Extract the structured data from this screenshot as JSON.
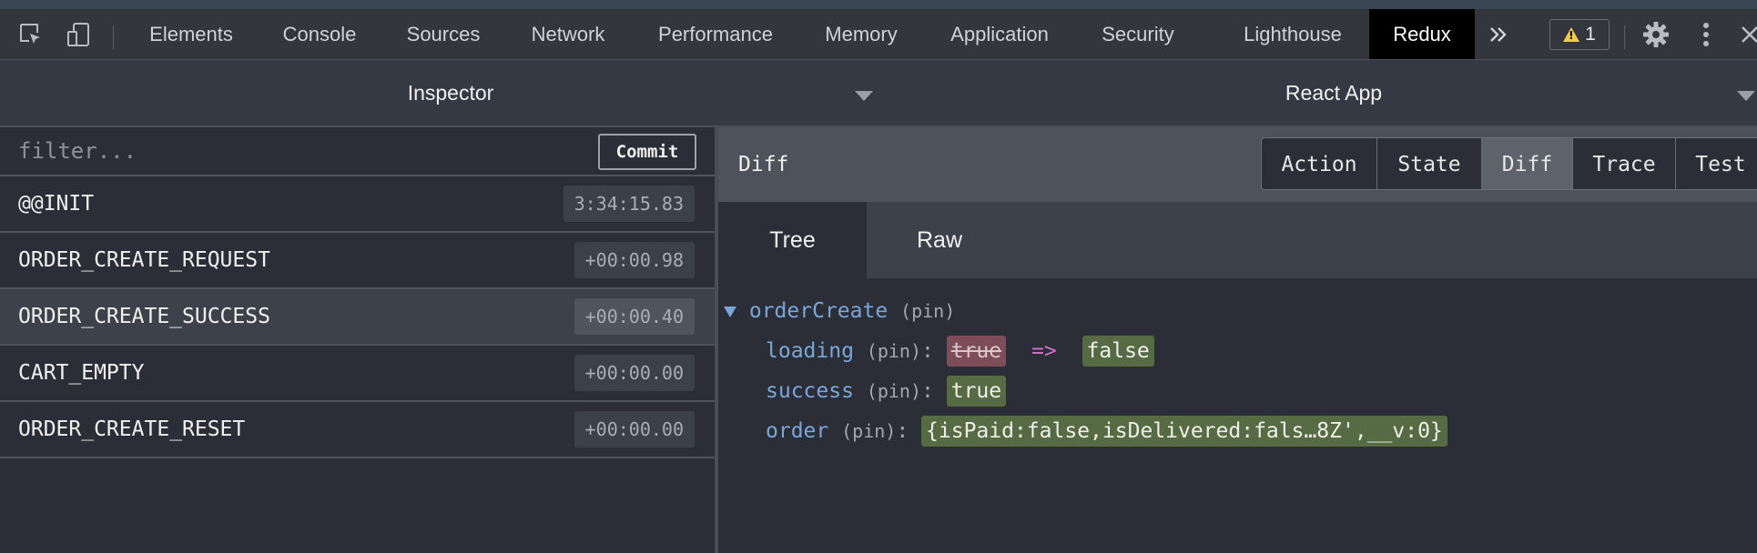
{
  "devtools_tabs": [
    "Elements",
    "Console",
    "Sources",
    "Network",
    "Performance",
    "Memory",
    "Application",
    "Security",
    "Lighthouse",
    "Redux"
  ],
  "active_tab": "Redux",
  "warning_count": "1",
  "inspector": {
    "left_title": "Inspector",
    "right_title": "React App"
  },
  "filter": {
    "placeholder": "filter...",
    "commit_label": "Commit"
  },
  "actions": [
    {
      "name": "@@INIT",
      "time": "3:34:15.83",
      "selected": false
    },
    {
      "name": "ORDER_CREATE_REQUEST",
      "time": "+00:00.98",
      "selected": false
    },
    {
      "name": "ORDER_CREATE_SUCCESS",
      "time": "+00:00.40",
      "selected": true
    },
    {
      "name": "CART_EMPTY",
      "time": "+00:00.00",
      "selected": false
    },
    {
      "name": "ORDER_CREATE_RESET",
      "time": "+00:00.00",
      "selected": false
    }
  ],
  "monitor": {
    "label": "Diff",
    "buttons": [
      "Action",
      "State",
      "Diff",
      "Trace",
      "Test"
    ],
    "active_button": "Diff"
  },
  "view_tabs": [
    "Tree",
    "Raw"
  ],
  "active_view_tab": "Tree",
  "diff": {
    "root_key": "orderCreate",
    "pin": "(pin)",
    "arrow": "=>",
    "entries": [
      {
        "key": "loading",
        "old": "true",
        "new": "false"
      },
      {
        "key": "success",
        "new": "true"
      },
      {
        "key": "order",
        "new": "{isPaid:false,isDelivered:fals…8Z',__v:0}"
      }
    ]
  }
}
